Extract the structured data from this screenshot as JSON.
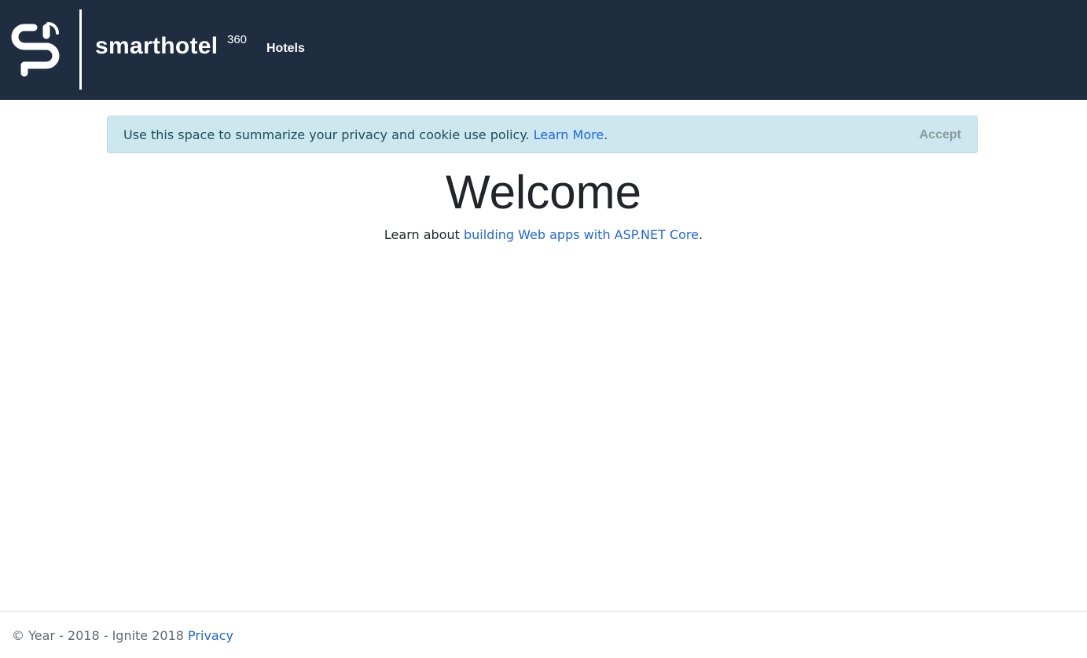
{
  "header": {
    "brand": {
      "name": "smarthotel",
      "sup": "360"
    },
    "nav": {
      "hotels": "Hotels"
    },
    "logo_icon": "smarthotel-logo-icon",
    "background": "#1e2d40"
  },
  "cookie_banner": {
    "text": "Use this space to summarize your privacy and cookie use policy.",
    "link": "Learn More",
    "link_suffix": ".",
    "accept": "Accept",
    "background": "#cce8ee"
  },
  "main": {
    "title": "Welcome",
    "intro_prefix": "Learn about",
    "intro_link": "building Web apps with ASP.NET Core",
    "intro_suffix": "."
  },
  "footer": {
    "text": "© Year - 2018 - Ignite 2018",
    "privacy": "Privacy"
  },
  "colors": {
    "link": "#1f67e5",
    "accept_text": "#8a9aa0",
    "footer_text": "#5f6973"
  }
}
